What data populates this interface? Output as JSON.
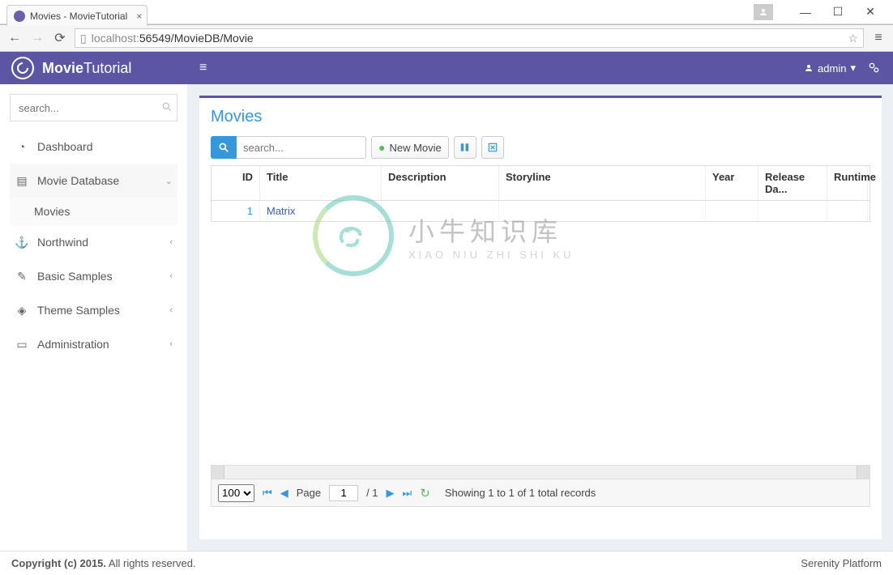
{
  "browser": {
    "tab_title": "Movies - MovieTutorial",
    "url_host": "localhost:",
    "url_port_path": "56549/MovieDB/Movie"
  },
  "header": {
    "brand_bold": "Movie",
    "brand_light": "Tutorial",
    "user": "admin"
  },
  "sidebar": {
    "search_placeholder": "search...",
    "items": [
      {
        "label": "Dashboard",
        "icon": "◔"
      },
      {
        "label": "Movie Database",
        "icon": "▤",
        "expanded": true
      },
      {
        "label": "Northwind",
        "icon": "⚓"
      },
      {
        "label": "Basic Samples",
        "icon": "✎"
      },
      {
        "label": "Theme Samples",
        "icon": "◈"
      },
      {
        "label": "Administration",
        "icon": "▭"
      }
    ],
    "sub_item": "Movies"
  },
  "panel": {
    "title": "Movies",
    "search_placeholder": "search...",
    "new_button": "New Movie",
    "columns": [
      "ID",
      "Title",
      "Description",
      "Storyline",
      "Year",
      "Release Da...",
      "Runtime"
    ],
    "rows": [
      {
        "id": "1",
        "title": "Matrix",
        "description": "",
        "storyline": "",
        "year": "",
        "release": "",
        "runtime": ""
      }
    ],
    "pager": {
      "page_size": "100",
      "page_label": "Page",
      "page": "1",
      "total_pages": "/ 1",
      "status": "Showing 1 to 1 of 1 total records"
    }
  },
  "footer": {
    "copyright_bold": "Copyright (c) 2015.",
    "copyright_rest": " All rights reserved.",
    "platform": "Serenity Platform"
  },
  "watermark": {
    "cn": "小牛知识库",
    "en": "XIAO NIU ZHI SHI KU"
  }
}
